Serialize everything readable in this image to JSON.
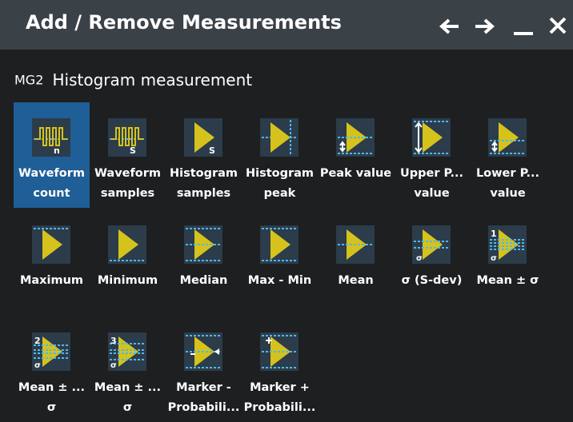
{
  "dialog": {
    "title": "Add / Remove Measurements",
    "buttons": [
      {
        "name": "back-arrow-icon"
      },
      {
        "name": "forward-arrow-icon"
      },
      {
        "name": "minimize-icon"
      },
      {
        "name": "close-icon"
      }
    ]
  },
  "group": {
    "id": "MG2",
    "title": "Histogram measurement"
  },
  "accent_colors": {
    "selected": "#1f5e96",
    "icon_yellow": "#d6c21c",
    "icon_line": "#4fb8ec",
    "icon_bg": "#2c3c4a",
    "titlebar": "#3a4147",
    "background": "#1d1f21"
  },
  "measurements": [
    {
      "label_1": "Waveform",
      "label_2": "count",
      "icon": "waveform-count-icon",
      "selected": true
    },
    {
      "label_1": "Waveform",
      "label_2": "samples",
      "icon": "waveform-samples-icon",
      "selected": false
    },
    {
      "label_1": "Histogram",
      "label_2": "samples",
      "icon": "histogram-samples-icon",
      "selected": false
    },
    {
      "label_1": "Histogram",
      "label_2": "peak",
      "icon": "histogram-peak-icon",
      "selected": false
    },
    {
      "label_1": "Peak value",
      "label_2": "",
      "icon": "peak-value-icon",
      "selected": false
    },
    {
      "label_1": "Upper P...",
      "label_2": "value",
      "icon": "upper-peak-value-icon",
      "selected": false
    },
    {
      "label_1": "Lower P...",
      "label_2": "value",
      "icon": "lower-peak-value-icon",
      "selected": false
    },
    {
      "label_1": "Maximum",
      "label_2": "",
      "icon": "maximum-icon",
      "selected": false
    },
    {
      "label_1": "Minimum",
      "label_2": "",
      "icon": "minimum-icon",
      "selected": false
    },
    {
      "label_1": "Median",
      "label_2": "",
      "icon": "median-icon",
      "selected": false
    },
    {
      "label_1": "Max - Min",
      "label_2": "",
      "icon": "max-min-icon",
      "selected": false
    },
    {
      "label_1": "Mean",
      "label_2": "",
      "icon": "mean-icon",
      "selected": false
    },
    {
      "label_1": "σ (S-dev)",
      "label_2": "",
      "icon": "std-dev-icon",
      "selected": false
    },
    {
      "label_1": "Mean ± σ",
      "label_2": "",
      "icon": "mean-plus-minus-sigma-icon",
      "selected": false
    },
    {
      "label_1": "Mean ± ...",
      "label_2": "σ",
      "icon": "mean-plus-minus-2-sigma-icon",
      "selected": false
    },
    {
      "label_1": "Mean ± ...",
      "label_2": "σ",
      "icon": "mean-plus-minus-3-sigma-icon",
      "selected": false
    },
    {
      "label_1": "Marker -",
      "label_2": "Probabili...",
      "icon": "marker-minus-probability-icon",
      "selected": false
    },
    {
      "label_1": "Marker +",
      "label_2": "Probabili...",
      "icon": "marker-plus-probability-icon",
      "selected": false
    }
  ]
}
